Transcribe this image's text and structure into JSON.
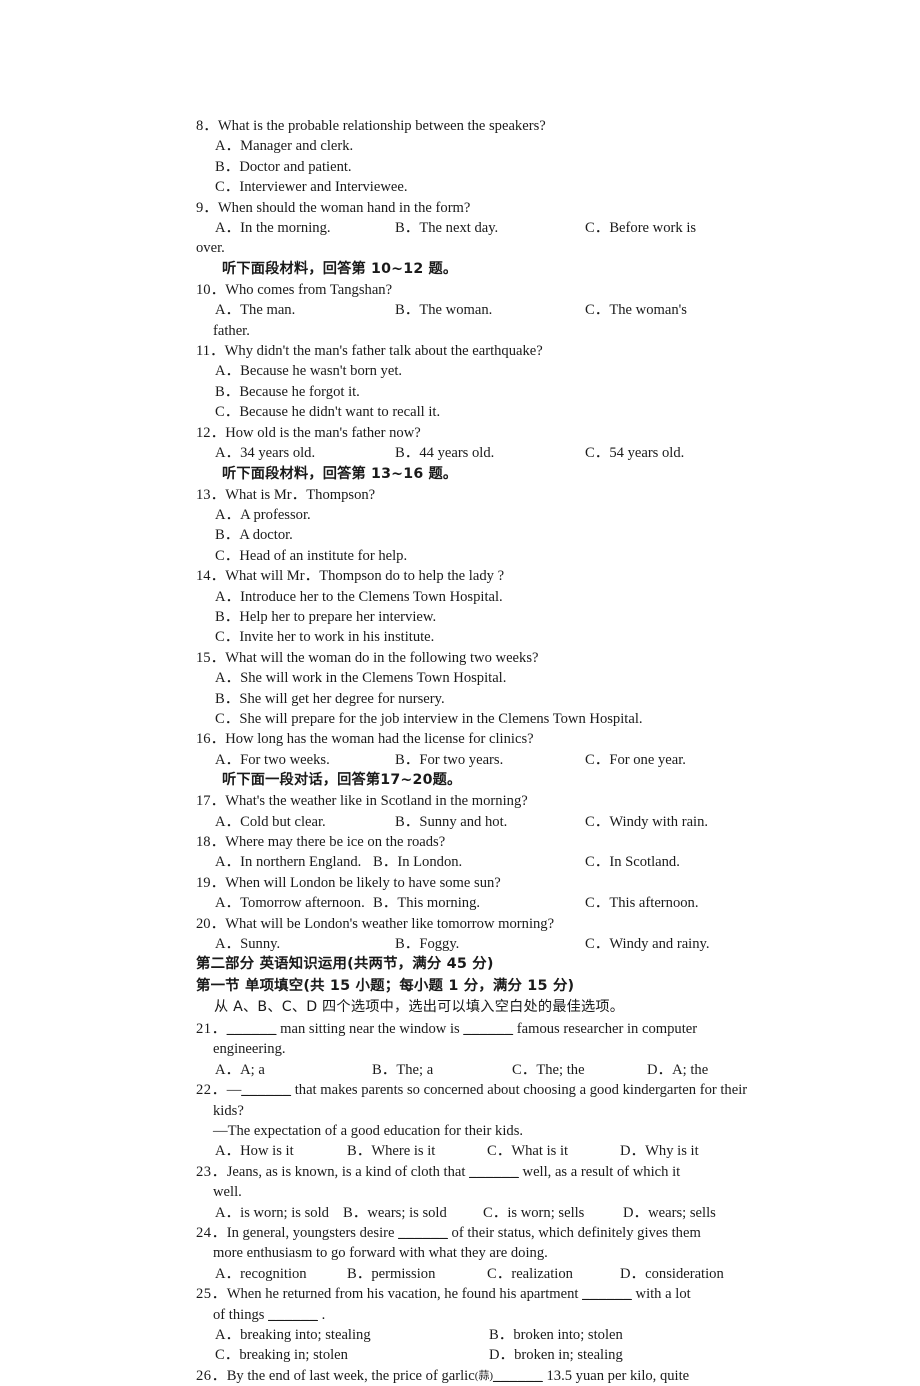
{
  "document": {
    "type": "exam-paper",
    "language": "English test with Chinese instructions"
  },
  "listening": {
    "q8": {
      "stem": "8．What is the probable relationship between the speakers?",
      "options": [
        "A．Manager and clerk.",
        "B．Doctor and patient.",
        "C．Interviewer and Interviewee."
      ]
    },
    "q9": {
      "stem": "9．When should the woman hand in the form?",
      "optA": "A．In the morning.",
      "optB": "B．The next day.",
      "optC": "C．Before work is",
      "wrap": "over."
    },
    "cue_10_12": "听下面段材料，回答第 10~12 题。",
    "q10": {
      "stem": "10．Who comes from Tangshan?",
      "optA": "A．The man.",
      "optB": "B．The woman.",
      "optC": "C．The woman's",
      "wrap": "father."
    },
    "q11": {
      "stem": "11．Why didn't the man's father talk about the earthquake?",
      "options": [
        "A．Because he wasn't born yet.",
        "B．Because he forgot it.",
        "C．Because he didn't want to recall it."
      ]
    },
    "q12": {
      "stem": "12．How old is the man's father now?",
      "optA": "A．34 years old.",
      "optB": "B．44 years old.",
      "optC": "C．54 years old."
    },
    "cue_13_16": "听下面段材料，回答第 13~16 题。",
    "q13": {
      "stem": "13．What is Mr．Thompson?",
      "options": [
        "A．A professor.",
        "B．A doctor.",
        "C．Head of an institute for help."
      ]
    },
    "q14": {
      "stem": "14．What will Mr．Thompson do to help the lady ?",
      "options": [
        "A．Introduce her to the Clemens Town Hospital.",
        "B．Help her to prepare her interview.",
        "C．Invite her to work in his institute."
      ]
    },
    "q15": {
      "stem": "15．What will the woman do in the following two weeks?",
      "options": [
        "A．She will work in the Clemens Town Hospital.",
        "B．She will get her degree for nursery.",
        "C．She will prepare for the job interview in the Clemens Town Hospital."
      ]
    },
    "q16": {
      "stem": "16．How long has the woman had the license for clinics?",
      "optA": "A．For two weeks.",
      "optB": "B．For two years.",
      "optC": "C．For one year."
    },
    "cue_17_20": "听下面一段对话，回答第17~20题。",
    "q17": {
      "stem": "17．What's the weather like in Scotland in the morning?",
      "optA": "A．Cold but clear.",
      "optB": "B．Sunny and hot.",
      "optC": "C．Windy with rain."
    },
    "q18": {
      "stem": "18．Where may there be ice on the roads?",
      "optA": "A．In northern England.",
      "optB": "B．In London.",
      "optC": "C．In Scotland."
    },
    "q19": {
      "stem": "19．When will London be likely to have some sun?",
      "optA": "A．Tomorrow afternoon.",
      "optB": "B．This morning.",
      "optC": "C．This afternoon."
    },
    "q20": {
      "stem": "20．What will be London's weather like tomorrow morning?",
      "optA": "A．Sunny.",
      "optB": "B．Foggy.",
      "optC": "C．Windy and rainy."
    }
  },
  "part_two": {
    "heading": "第二部分 英语知识运用(共两节，满分 45 分)",
    "section_one_heading": "第一节 单项填空(共 15 小题；每小题 1 分，满分 15 分)",
    "directions": "从 A、B、C、D 四个选项中，选出可以填入空白处的最佳选项。"
  },
  "grammar": {
    "q21": {
      "num": "21．",
      "pre": " man sitting near the window is ",
      "post": " famous researcher in computer",
      "wrap": "engineering.",
      "optA": "A．A; a",
      "optB": "B．The; a",
      "optC": "C．The; the",
      "optD": "D．A; the"
    },
    "q22": {
      "num": "22．",
      "pre": "—",
      "post": " that makes parents so concerned about choosing a good kindergarten for their",
      "wrap": "kids?",
      "answer_line": "—The expectation of a good education for their kids.",
      "optA": "A．How is it",
      "optB": "B．Where is it",
      "optC": "C．What is it",
      "optD": "D．Why is it"
    },
    "q23": {
      "num": "23．",
      "pre": "Jeans, as is known, is a kind of cloth that ",
      "post": " well, as a result of which it",
      "wrap": "well.",
      "optA": "A．is worn; is sold",
      "optB": "B．wears; is sold",
      "optC": "C．is worn; sells",
      "optD": "D．wears; sells"
    },
    "q24": {
      "num": "24．",
      "pre": "In general, youngsters desire ",
      "post": " of their status, which definitely gives them",
      "wrap": "more enthusiasm to go forward with what they are doing.",
      "optA": "A．recognition",
      "optB": "B．permission",
      "optC": "C．realization",
      "optD": "D．consideration"
    },
    "q25": {
      "num": "25．",
      "pre": "When he returned from his vacation, he found his apartment ",
      "post": " with a lot",
      "wrap_pre": "of things ",
      "wrap_post": " .",
      "optA": "A．breaking into; stealing",
      "optB": "B．broken into; stolen",
      "optC": "C．breaking in; stolen",
      "optD": "D．broken in; stealing"
    },
    "q26": {
      "num": "26．",
      "pre": "By the end of last week, the price of garlic",
      "gloss": "(蒜)",
      "post": " 13.5 yuan per kilo, quite"
    },
    "blank_glyph": "______"
  }
}
